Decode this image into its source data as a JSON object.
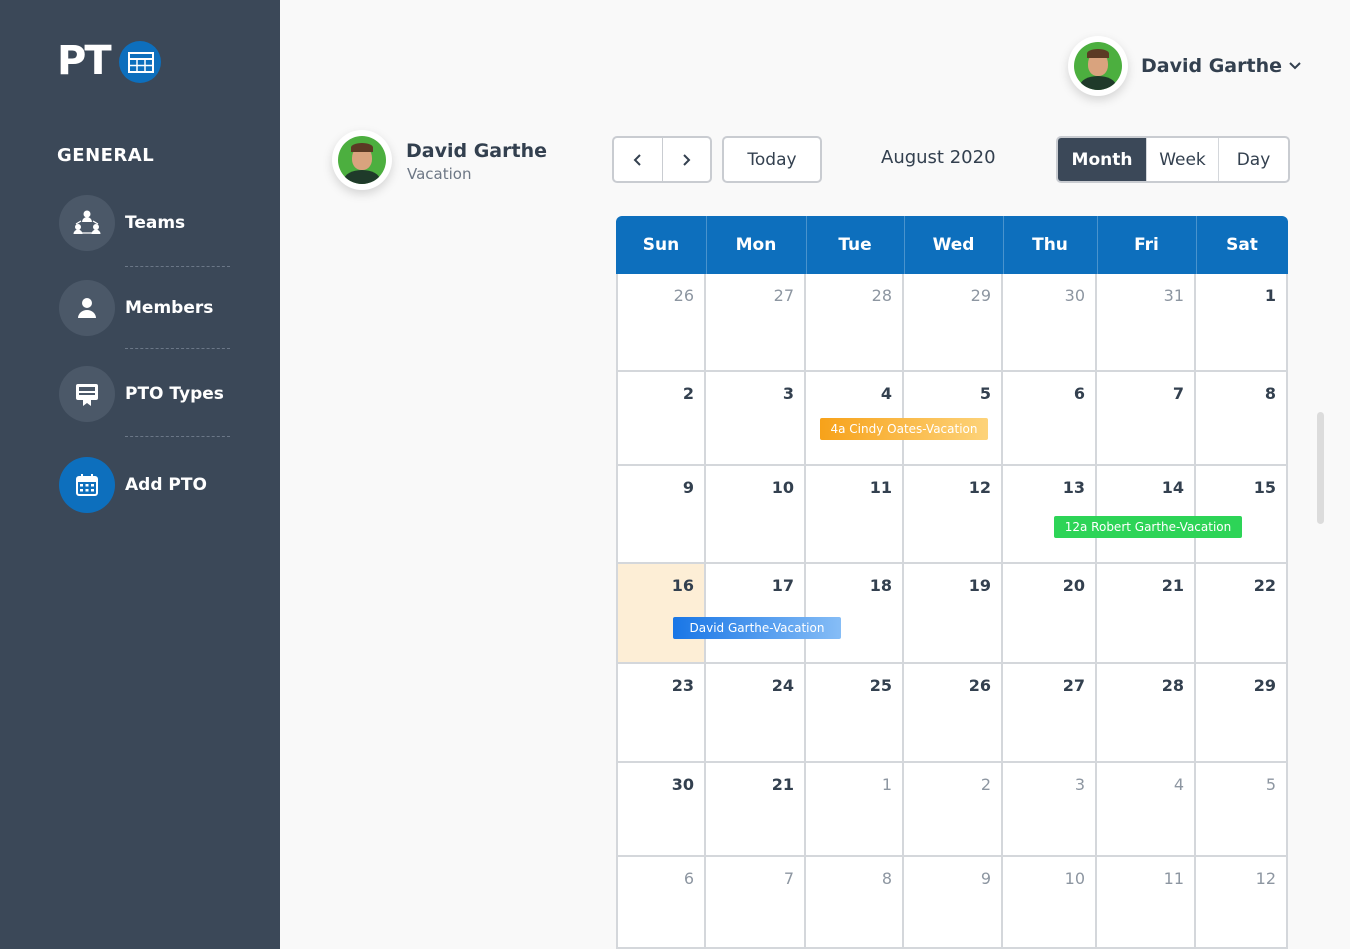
{
  "app": {
    "logo_text": "PT",
    "brand_color": "#0d6fbd",
    "sidebar_color": "#3b4858"
  },
  "sidebar": {
    "section_title": "GENERAL",
    "items": [
      {
        "label": "Teams",
        "icon": "teams-icon"
      },
      {
        "label": "Members",
        "icon": "member-icon"
      },
      {
        "label": "PTO Types",
        "icon": "pto-types-icon"
      },
      {
        "label": "Add PTO",
        "icon": "calendar-icon",
        "active": true
      }
    ]
  },
  "header": {
    "user_name": "David Garthe"
  },
  "profile": {
    "name": "David Garthe",
    "pto_type": "Vacation"
  },
  "toolbar": {
    "today_label": "Today",
    "month_title": "August 2020",
    "views": [
      "Month",
      "Week",
      "Day"
    ],
    "active_view": "Month"
  },
  "calendar": {
    "weekdays": [
      "Sun",
      "Mon",
      "Tue",
      "Wed",
      "Thu",
      "Fri",
      "Sat"
    ],
    "weeks": [
      [
        {
          "d": "26",
          "m": true
        },
        {
          "d": "27",
          "m": true
        },
        {
          "d": "28",
          "m": true
        },
        {
          "d": "29",
          "m": true
        },
        {
          "d": "30",
          "m": true
        },
        {
          "d": "31",
          "m": true
        },
        {
          "d": "1"
        }
      ],
      [
        {
          "d": "2"
        },
        {
          "d": "3"
        },
        {
          "d": "4"
        },
        {
          "d": "5"
        },
        {
          "d": "6"
        },
        {
          "d": "7"
        },
        {
          "d": "8"
        }
      ],
      [
        {
          "d": "9"
        },
        {
          "d": "10"
        },
        {
          "d": "11"
        },
        {
          "d": "12"
        },
        {
          "d": "13"
        },
        {
          "d": "14"
        },
        {
          "d": "15"
        }
      ],
      [
        {
          "d": "16",
          "today": true
        },
        {
          "d": "17"
        },
        {
          "d": "18"
        },
        {
          "d": "19"
        },
        {
          "d": "20"
        },
        {
          "d": "21"
        },
        {
          "d": "22"
        }
      ],
      [
        {
          "d": "23"
        },
        {
          "d": "24"
        },
        {
          "d": "25"
        },
        {
          "d": "26"
        },
        {
          "d": "27"
        },
        {
          "d": "28"
        },
        {
          "d": "29"
        }
      ],
      [
        {
          "d": "30"
        },
        {
          "d": "21"
        },
        {
          "d": "1",
          "m": true
        },
        {
          "d": "2",
          "m": true
        },
        {
          "d": "3",
          "m": true
        },
        {
          "d": "4",
          "m": true
        },
        {
          "d": "5",
          "m": true
        }
      ],
      [
        {
          "d": "6",
          "m": true
        },
        {
          "d": "7",
          "m": true
        },
        {
          "d": "8",
          "m": true
        },
        {
          "d": "9",
          "m": true
        },
        {
          "d": "10",
          "m": true
        },
        {
          "d": "11",
          "m": true
        },
        {
          "d": "12",
          "m": true
        }
      ]
    ],
    "events": [
      {
        "label": "4a Cindy Oates-Vacation",
        "color": "#f7a21a"
      },
      {
        "label": "12a Robert Garthe-Vacation",
        "color": "#2dd457"
      },
      {
        "label": "David Garthe-Vacation",
        "color": "#1976e6"
      }
    ]
  }
}
